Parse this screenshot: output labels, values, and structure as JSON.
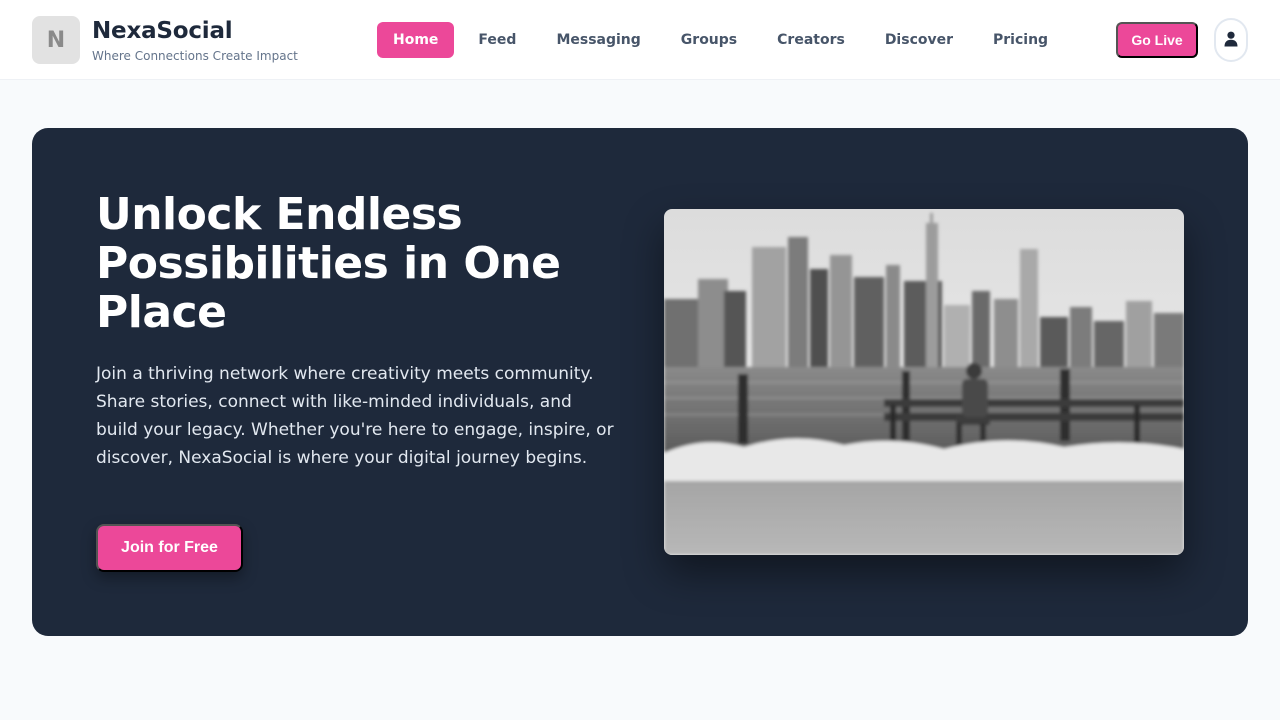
{
  "brand": {
    "logo_letter": "N",
    "name": "NexaSocial",
    "tagline": "Where Connections Create Impact"
  },
  "nav": {
    "items": [
      {
        "label": "Home",
        "active": true
      },
      {
        "label": "Feed",
        "active": false
      },
      {
        "label": "Messaging",
        "active": false
      },
      {
        "label": "Groups",
        "active": false
      },
      {
        "label": "Creators",
        "active": false
      },
      {
        "label": "Discover",
        "active": false
      },
      {
        "label": "Pricing",
        "active": false
      }
    ]
  },
  "header_actions": {
    "go_live_label": "Go Live",
    "profile_icon": "user-icon"
  },
  "hero": {
    "title": "Unlock Endless Possibilities in One Place",
    "description": "Join a thriving network where creativity meets community. Share stories, connect with like-minded individuals, and build your legacy. Whether you're here to engage, inspire, or discover, NexaSocial is where your digital journey begins.",
    "cta_label": "Join for Free"
  },
  "colors": {
    "accent": "#ec4899",
    "hero_background": "#1e293b",
    "page_background": "#f8fafc"
  }
}
